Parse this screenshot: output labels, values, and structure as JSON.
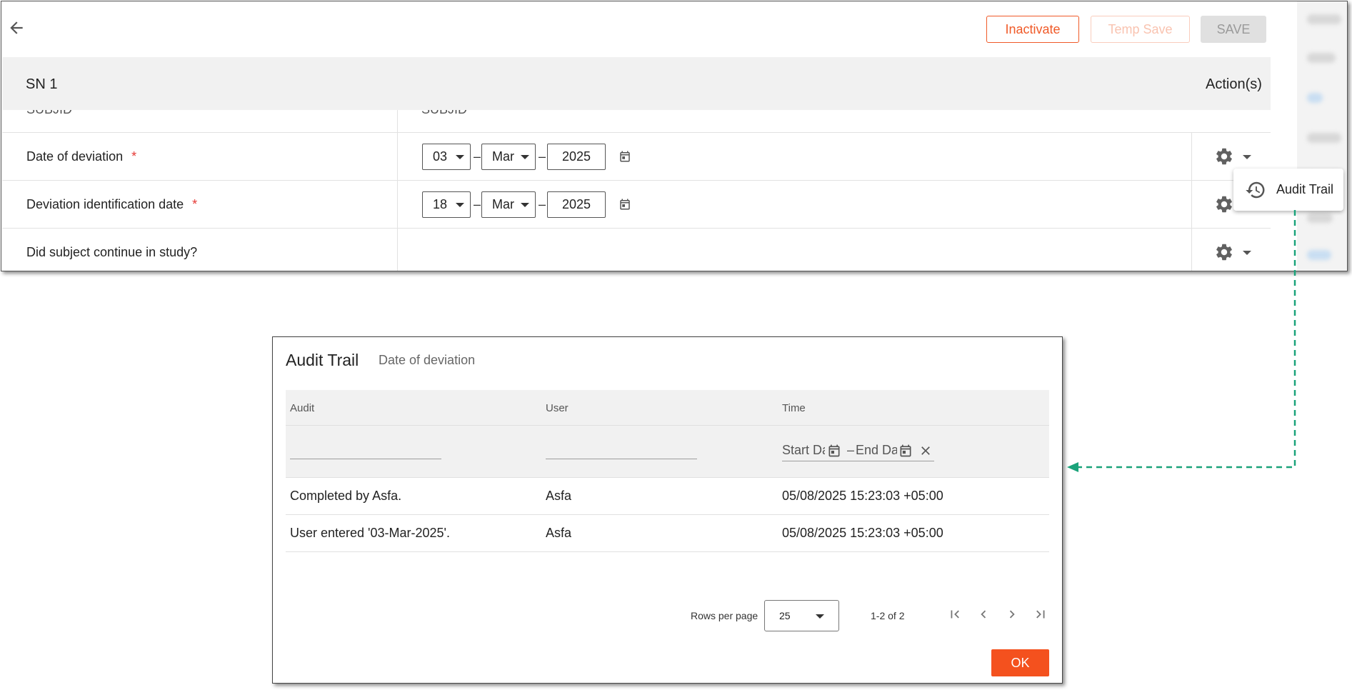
{
  "toolbar": {
    "inactivate_label": "Inactivate",
    "temp_save_label": "Temp Save",
    "save_label": "SAVE"
  },
  "form": {
    "header_title": "SN 1",
    "actions_title": "Action(s)",
    "cut_row": {
      "label": "SUBJID",
      "value": "SUBJID"
    },
    "rows": [
      {
        "label": "Date of deviation",
        "required": "*",
        "day": "03",
        "month": "Mar",
        "year": "2025",
        "sep1": "–",
        "sep2": "–"
      },
      {
        "label": "Deviation identification date",
        "required": "*",
        "day": "18",
        "month": "Mar",
        "year": "2025",
        "sep1": "–",
        "sep2": "–"
      },
      {
        "label": "Did subject continue in study?"
      }
    ],
    "action_menu": {
      "audit_trail_label": "Audit Trail"
    }
  },
  "dialog": {
    "title": "Audit Trail",
    "subtitle": "Date of deviation",
    "columns": {
      "audit": "Audit",
      "user": "User",
      "time": "Time"
    },
    "date_filter": {
      "start_placeholder": "Start Date",
      "separator": "–",
      "end_placeholder": "End Date"
    },
    "rows": [
      {
        "audit": "Completed by Asfa.",
        "user": "Asfa",
        "time": "05/08/2025 15:23:03 +05:00"
      },
      {
        "audit": "User entered '03-Mar-2025'.",
        "user": "Asfa",
        "time": "05/08/2025 15:23:03 +05:00"
      }
    ],
    "pager": {
      "rows_per_page_label": "Rows per page",
      "rows_per_page_value": "25",
      "range_text": "1-2 of 2"
    },
    "ok_label": "OK"
  },
  "colors": {
    "accent": "#f4511e",
    "outline_accent": "#f05a28",
    "required": "#e53935",
    "connector": "#1aa37a"
  },
  "icons": [
    "back-arrow-icon",
    "calendar-icon",
    "gear-icon",
    "history-icon",
    "close-icon",
    "first-page-icon",
    "previous-page-icon",
    "next-page-icon",
    "last-page-icon"
  ]
}
